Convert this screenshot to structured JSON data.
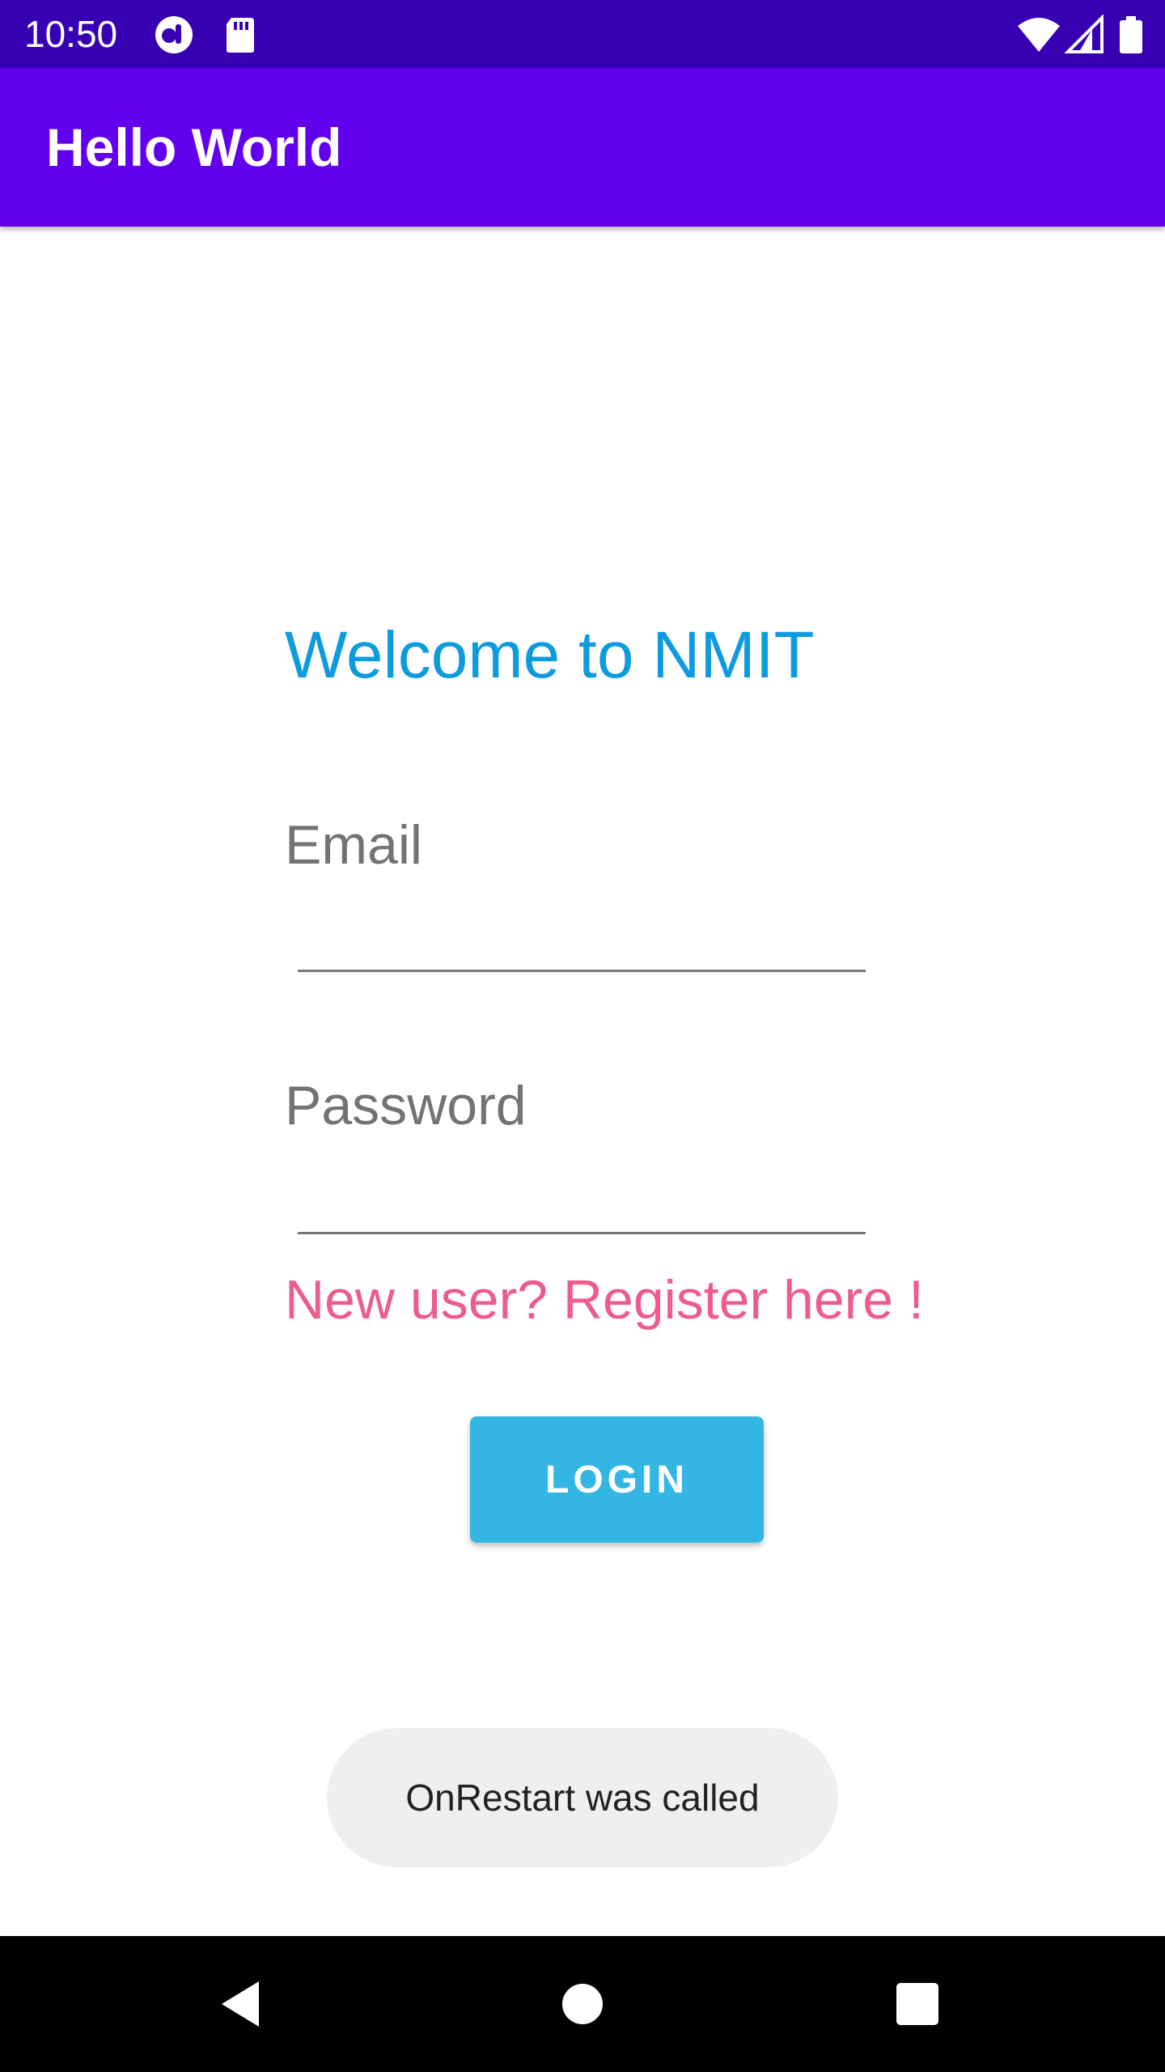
{
  "status_bar": {
    "time": "10:50",
    "icons": [
      "circle-notification-icon",
      "sd-card-icon",
      "wifi-icon",
      "cell-signal-icon",
      "battery-icon"
    ],
    "color": "#3700b3"
  },
  "app_bar": {
    "title": "Hello World",
    "color": "#6200ee"
  },
  "main": {
    "welcome_text": "Welcome to NMIT",
    "email": {
      "placeholder": "Email",
      "value": ""
    },
    "password": {
      "placeholder": "Password",
      "value": ""
    },
    "register_link": "New user? Register here !",
    "login_button": "LOGIN"
  },
  "toast": {
    "message": "OnRestart was called"
  },
  "nav_bar": {
    "buttons": [
      "back-icon",
      "home-icon",
      "recents-icon"
    ]
  },
  "colors": {
    "welcome": "#0d9be0",
    "register": "#ee5b8e",
    "login_button": "#34b6e4"
  }
}
